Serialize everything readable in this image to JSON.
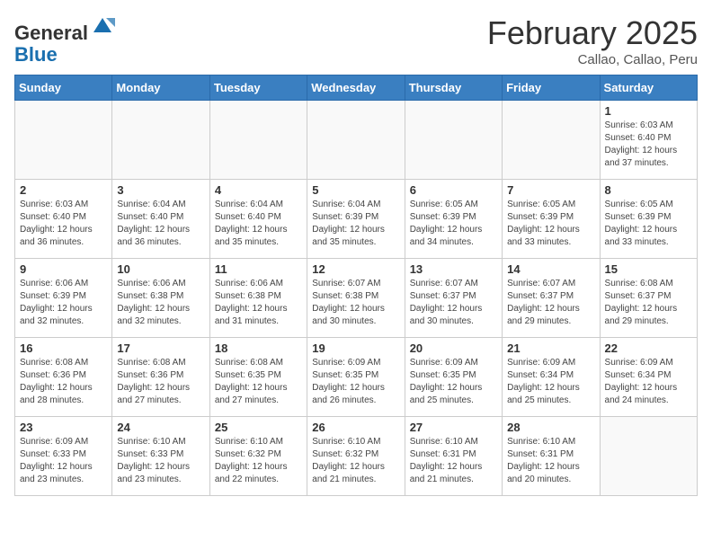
{
  "header": {
    "logo_general": "General",
    "logo_blue": "Blue",
    "month_year": "February 2025",
    "location": "Callao, Callao, Peru"
  },
  "weekdays": [
    "Sunday",
    "Monday",
    "Tuesday",
    "Wednesday",
    "Thursday",
    "Friday",
    "Saturday"
  ],
  "weeks": [
    [
      {
        "day": "",
        "info": ""
      },
      {
        "day": "",
        "info": ""
      },
      {
        "day": "",
        "info": ""
      },
      {
        "day": "",
        "info": ""
      },
      {
        "day": "",
        "info": ""
      },
      {
        "day": "",
        "info": ""
      },
      {
        "day": "1",
        "info": "Sunrise: 6:03 AM\nSunset: 6:40 PM\nDaylight: 12 hours and 37 minutes."
      }
    ],
    [
      {
        "day": "2",
        "info": "Sunrise: 6:03 AM\nSunset: 6:40 PM\nDaylight: 12 hours and 36 minutes."
      },
      {
        "day": "3",
        "info": "Sunrise: 6:04 AM\nSunset: 6:40 PM\nDaylight: 12 hours and 36 minutes."
      },
      {
        "day": "4",
        "info": "Sunrise: 6:04 AM\nSunset: 6:40 PM\nDaylight: 12 hours and 35 minutes."
      },
      {
        "day": "5",
        "info": "Sunrise: 6:04 AM\nSunset: 6:39 PM\nDaylight: 12 hours and 35 minutes."
      },
      {
        "day": "6",
        "info": "Sunrise: 6:05 AM\nSunset: 6:39 PM\nDaylight: 12 hours and 34 minutes."
      },
      {
        "day": "7",
        "info": "Sunrise: 6:05 AM\nSunset: 6:39 PM\nDaylight: 12 hours and 33 minutes."
      },
      {
        "day": "8",
        "info": "Sunrise: 6:05 AM\nSunset: 6:39 PM\nDaylight: 12 hours and 33 minutes."
      }
    ],
    [
      {
        "day": "9",
        "info": "Sunrise: 6:06 AM\nSunset: 6:39 PM\nDaylight: 12 hours and 32 minutes."
      },
      {
        "day": "10",
        "info": "Sunrise: 6:06 AM\nSunset: 6:38 PM\nDaylight: 12 hours and 32 minutes."
      },
      {
        "day": "11",
        "info": "Sunrise: 6:06 AM\nSunset: 6:38 PM\nDaylight: 12 hours and 31 minutes."
      },
      {
        "day": "12",
        "info": "Sunrise: 6:07 AM\nSunset: 6:38 PM\nDaylight: 12 hours and 30 minutes."
      },
      {
        "day": "13",
        "info": "Sunrise: 6:07 AM\nSunset: 6:37 PM\nDaylight: 12 hours and 30 minutes."
      },
      {
        "day": "14",
        "info": "Sunrise: 6:07 AM\nSunset: 6:37 PM\nDaylight: 12 hours and 29 minutes."
      },
      {
        "day": "15",
        "info": "Sunrise: 6:08 AM\nSunset: 6:37 PM\nDaylight: 12 hours and 29 minutes."
      }
    ],
    [
      {
        "day": "16",
        "info": "Sunrise: 6:08 AM\nSunset: 6:36 PM\nDaylight: 12 hours and 28 minutes."
      },
      {
        "day": "17",
        "info": "Sunrise: 6:08 AM\nSunset: 6:36 PM\nDaylight: 12 hours and 27 minutes."
      },
      {
        "day": "18",
        "info": "Sunrise: 6:08 AM\nSunset: 6:35 PM\nDaylight: 12 hours and 27 minutes."
      },
      {
        "day": "19",
        "info": "Sunrise: 6:09 AM\nSunset: 6:35 PM\nDaylight: 12 hours and 26 minutes."
      },
      {
        "day": "20",
        "info": "Sunrise: 6:09 AM\nSunset: 6:35 PM\nDaylight: 12 hours and 25 minutes."
      },
      {
        "day": "21",
        "info": "Sunrise: 6:09 AM\nSunset: 6:34 PM\nDaylight: 12 hours and 25 minutes."
      },
      {
        "day": "22",
        "info": "Sunrise: 6:09 AM\nSunset: 6:34 PM\nDaylight: 12 hours and 24 minutes."
      }
    ],
    [
      {
        "day": "23",
        "info": "Sunrise: 6:09 AM\nSunset: 6:33 PM\nDaylight: 12 hours and 23 minutes."
      },
      {
        "day": "24",
        "info": "Sunrise: 6:10 AM\nSunset: 6:33 PM\nDaylight: 12 hours and 23 minutes."
      },
      {
        "day": "25",
        "info": "Sunrise: 6:10 AM\nSunset: 6:32 PM\nDaylight: 12 hours and 22 minutes."
      },
      {
        "day": "26",
        "info": "Sunrise: 6:10 AM\nSunset: 6:32 PM\nDaylight: 12 hours and 21 minutes."
      },
      {
        "day": "27",
        "info": "Sunrise: 6:10 AM\nSunset: 6:31 PM\nDaylight: 12 hours and 21 minutes."
      },
      {
        "day": "28",
        "info": "Sunrise: 6:10 AM\nSunset: 6:31 PM\nDaylight: 12 hours and 20 minutes."
      },
      {
        "day": "",
        "info": ""
      }
    ]
  ]
}
